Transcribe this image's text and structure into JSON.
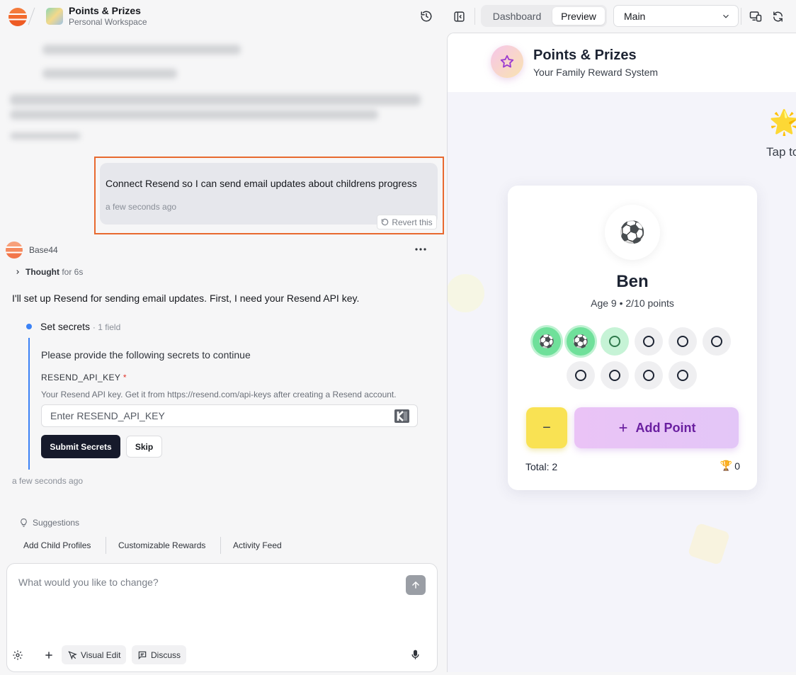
{
  "header": {
    "app_title": "Points & Prizes",
    "workspace": "Personal Workspace",
    "tabs": [
      "Dashboard",
      "Preview"
    ],
    "active_tab": "Preview",
    "branch": "Main"
  },
  "chat": {
    "user_message": "Connect Resend so I can send email updates about childrens progress",
    "user_time": "a few seconds ago",
    "revert_label": "Revert this",
    "bot_name": "Base44",
    "thought_label": "Thought",
    "thought_duration": "for 6s",
    "bot_text": "I'll set up Resend for sending email updates. First, I need your Resend API key.",
    "step_title": "Set secrets",
    "step_meta": "· 1 field",
    "secrets_intro": "Please provide the following secrets to continue",
    "key_name": "RESEND_API_KEY",
    "key_required_mark": "*",
    "key_help": "Your Resend API key. Get it from https://resend.com/api-keys after creating a Resend account.",
    "key_placeholder": "Enter RESEND_API_KEY",
    "submit_label": "Submit Secrets",
    "skip_label": "Skip",
    "bot_time": "a few seconds ago",
    "suggestions_label": "Suggestions",
    "suggestions": [
      "Add Child Profiles",
      "Customizable Rewards",
      "Activity Feed"
    ]
  },
  "composer": {
    "placeholder": "What would you like to change?",
    "visual_edit_label": "Visual Edit",
    "discuss_label": "Discuss"
  },
  "preview": {
    "title": "Points & Prizes",
    "subtitle": "Your Family Reward System",
    "tap_hint": "Tap to",
    "star_emoji": "🌟",
    "child": {
      "avatar": "⚽",
      "name": "Ben",
      "meta": "Age 9 • 2/10 points",
      "points_earned": 2,
      "points_goal": 10,
      "point_emoji": "⚽",
      "minus_label": "−",
      "add_label": "Add Point",
      "total_label": "Total: 2",
      "trophies": "0",
      "trophy_emoji": "🏆"
    }
  },
  "colors": {
    "accent_outline": "#e8692f",
    "step_line": "#3b82f6",
    "submit_bg": "#161a2b",
    "add_point_text": "#6a1fa0",
    "minus_bg": "#f9e253"
  }
}
